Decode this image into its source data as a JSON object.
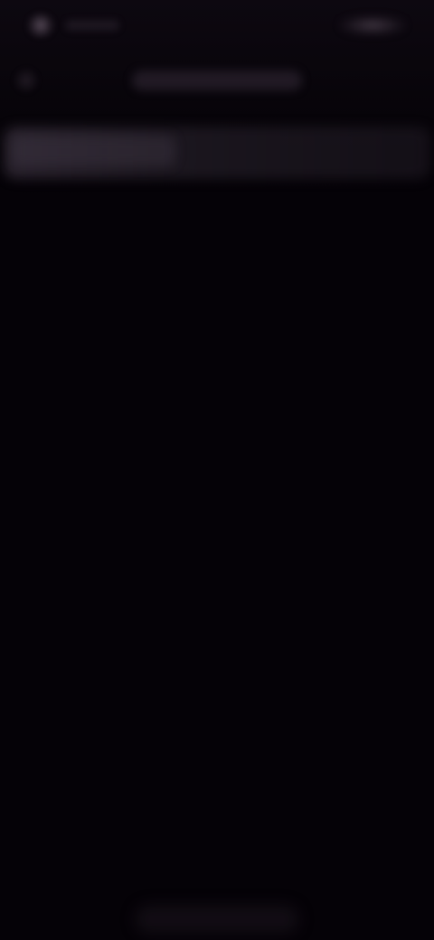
{
  "status_bar": {
    "time": "",
    "indicators": "signal-battery-icon"
  },
  "app_bar": {
    "back_icon": "back-arrow-icon",
    "title": ""
  },
  "banner": {
    "text": ""
  },
  "content": {
    "items": []
  },
  "colors": {
    "background": "#050207",
    "surface": "#2e2632",
    "muted": "#8c7a8c"
  }
}
